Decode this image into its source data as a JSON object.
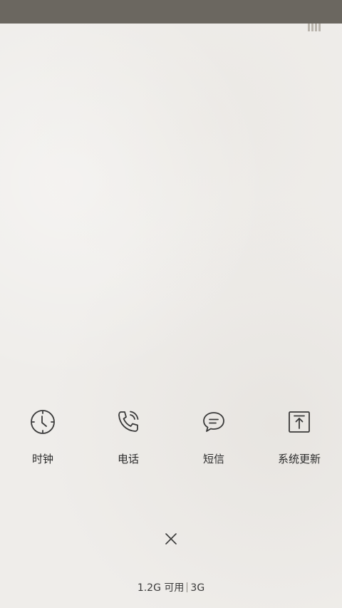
{
  "shortcuts": [
    {
      "label": "时钟",
      "icon": "clock-icon"
    },
    {
      "label": "电话",
      "icon": "phone-icon"
    },
    {
      "label": "短信",
      "icon": "message-icon"
    },
    {
      "label": "系统更新",
      "icon": "system-update-icon"
    }
  ],
  "memory": {
    "available": "1.2G 可用",
    "network": "3G"
  },
  "colors": {
    "status_bar": "#6b6760",
    "background": "#efedea",
    "icon_stroke": "#3a3a3a",
    "text": "#2c2c2c"
  }
}
